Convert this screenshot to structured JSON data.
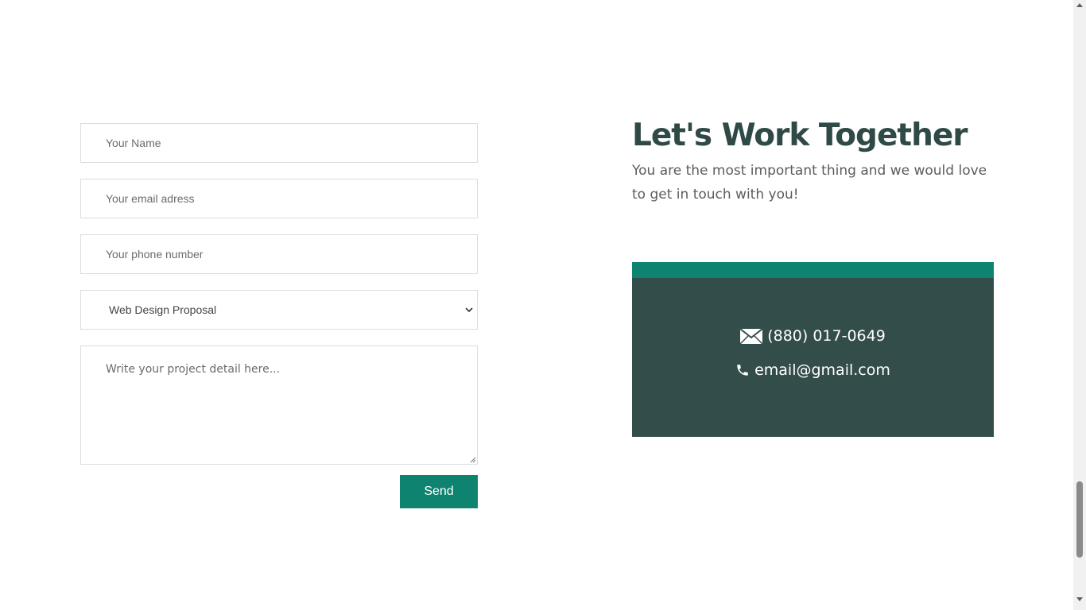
{
  "form": {
    "name_placeholder": "Your Name",
    "email_placeholder": "Your email adress",
    "phone_placeholder": "Your phone number",
    "subject_selected": "Web Design Proposal",
    "message_placeholder": "Write your project detail here...",
    "send_label": "Send"
  },
  "contact": {
    "heading": "Let's Work Together",
    "subtext": "You are the most important thing and we would love to get in touch with you!",
    "phone": "(880) 017-0649",
    "phone_icon": "envelope-icon",
    "email": "email@gmail.com",
    "email_icon": "phone-icon"
  },
  "colors": {
    "accent": "#0e8470",
    "card_bg": "#334d4a",
    "heading": "#2f4a46"
  }
}
